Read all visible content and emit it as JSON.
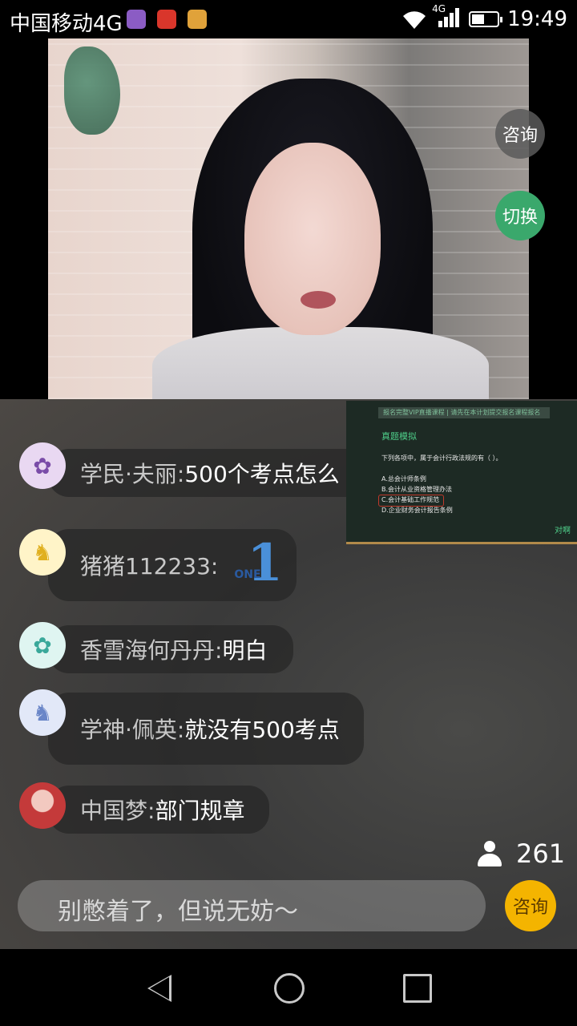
{
  "status_bar": {
    "carrier": "中国移动4G",
    "network": "4G",
    "time": "19:49",
    "app_icons": [
      "gallery-icon",
      "huawei-icon",
      "hand-app-icon"
    ]
  },
  "video": {
    "consult_label": "咨询",
    "switch_label": "切换"
  },
  "slide": {
    "header": "报名完整VIP直播课程  |  请先在本计划提交报名课程报名",
    "title": "真题模拟",
    "question": "下列各项中，属于会计行政法规的有（   ）。",
    "options": [
      "A.总会计师条例",
      "B.会计从业资格管理办法",
      "C.会计基础工作规范",
      "D.企业财务会计报告条例"
    ],
    "logo": "对啊"
  },
  "messages": [
    {
      "name": "学民·夫丽:",
      "text": "500个考点怎么",
      "avatar": "reindeer",
      "avatar_color": "#e9d8f2"
    },
    {
      "name": "猪猪112233:",
      "text": "",
      "badge": "1",
      "badge_text": "ONE",
      "avatar": "horse",
      "avatar_color": "#fff4c8"
    },
    {
      "name": "香雪海何丹丹:",
      "text": "明白",
      "avatar": "reindeer",
      "avatar_color": "#dff5f1"
    },
    {
      "name": "学神·佩英:",
      "text": "就没有500考点",
      "avatar": "horse",
      "avatar_color": "#e2e8f8"
    },
    {
      "name": "中国梦:",
      "text": "部门规章",
      "avatar": "photo",
      "avatar_color": "#c43a3a"
    }
  ],
  "viewers": {
    "count": "261"
  },
  "input": {
    "placeholder": "别憋着了，但说无妨～",
    "consult_label": "咨询"
  },
  "colors": {
    "switch": "#3aa86c",
    "consult": "#f4b400",
    "one_blue": "#4a90d9"
  }
}
